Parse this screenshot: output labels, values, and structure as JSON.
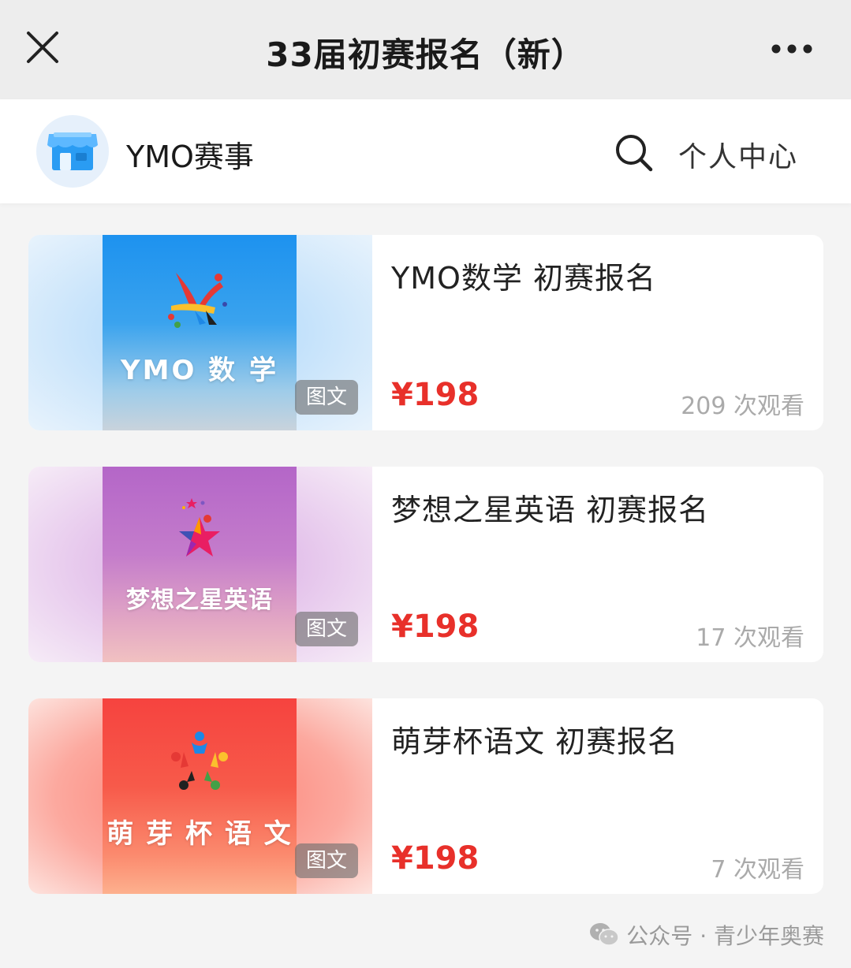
{
  "topbar": {
    "title": "33届初赛报名（新）",
    "close_icon": "close-icon",
    "more_icon": "more-dots-icon"
  },
  "store": {
    "name": "YMO赛事",
    "avatar_icon": "store-icon",
    "search_icon": "search-icon",
    "profile_label": "个人中心"
  },
  "cards": [
    {
      "title": "YMO数学 初赛报名",
      "price": "¥198",
      "views": "209 次观看",
      "badge": "图文",
      "poster_title": "YMO 数 学",
      "poster_color": "#2196f3"
    },
    {
      "title": "梦想之星英语 初赛报名",
      "price": "¥198",
      "views": "17 次观看",
      "badge": "图文",
      "poster_title": "梦想之星英语",
      "poster_color": "#b86fc8"
    },
    {
      "title": "萌芽杯语文 初赛报名",
      "price": "¥198",
      "views": "7 次观看",
      "badge": "图文",
      "poster_title": "萌 芽 杯 语 文",
      "poster_color": "#f6524a"
    }
  ],
  "footer": {
    "watermark": "公众号 · 青少年奥赛",
    "watermark_icon": "wechat-icon"
  },
  "colors": {
    "price": "#e8302a",
    "topbar_bg": "#ededed",
    "page_bg": "#f4f4f4"
  }
}
